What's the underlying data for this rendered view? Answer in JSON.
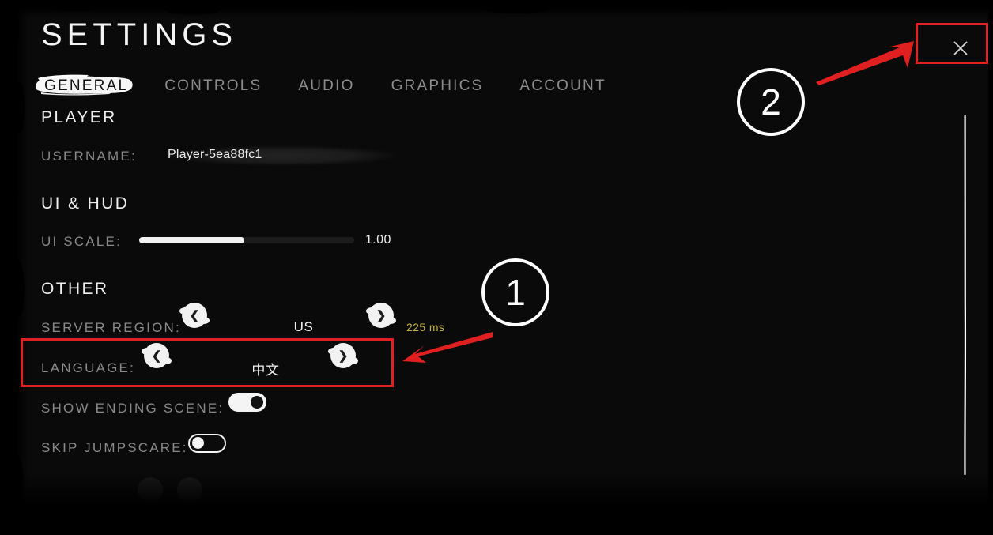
{
  "window": {
    "title": "SETTINGS",
    "close_icon": "close-x-icon"
  },
  "tabs": [
    {
      "label": "GENERAL",
      "active": true
    },
    {
      "label": "CONTROLS",
      "active": false
    },
    {
      "label": "AUDIO",
      "active": false
    },
    {
      "label": "GRAPHICS",
      "active": false
    },
    {
      "label": "ACCOUNT",
      "active": false
    }
  ],
  "sections": {
    "player": {
      "heading": "PLAYER",
      "username": {
        "label": "USERNAME:",
        "value": "Player-5ea88fc1"
      }
    },
    "ui_hud": {
      "heading": "UI & HUD",
      "ui_scale": {
        "label": "UI SCALE:",
        "value": "1.00",
        "fill_percent": 49
      }
    },
    "other": {
      "heading": "OTHER",
      "server_region": {
        "label": "SERVER REGION:",
        "value": "US",
        "ping": "225 ms",
        "prev_icon": "chevron-left-icon",
        "next_icon": "chevron-right-icon"
      },
      "language": {
        "label": "LANGUAGE:",
        "value": "中文",
        "prev_icon": "chevron-left-icon",
        "next_icon": "chevron-right-icon"
      },
      "show_ending_scene": {
        "label": "SHOW ENDING SCENE:",
        "state": "on"
      },
      "skip_jumpscare": {
        "label": "SKIP JUMPSCARE:",
        "state": "off"
      }
    }
  },
  "annotations": {
    "marker_one": "①",
    "marker_one_number": "1",
    "marker_two_number": "2",
    "color": "#e02020"
  },
  "colors": {
    "accent_ping": "#c8b23c",
    "annotation_red": "#e02020",
    "text_primary": "#f2f2f2",
    "text_muted": "#8a8a8a",
    "background": "#000000"
  }
}
